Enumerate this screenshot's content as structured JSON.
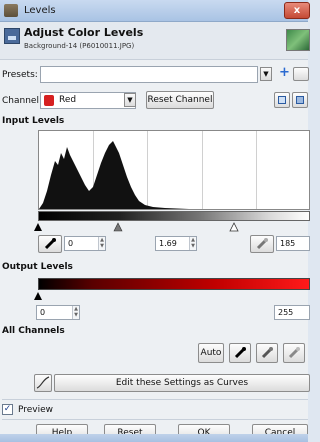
{
  "window": {
    "title": "Levels",
    "close_label": "x"
  },
  "header": {
    "title": "Adjust Color Levels",
    "subtitle": "Background-14 (P6010011.JPG)"
  },
  "presets": {
    "label": "Presets:",
    "value": ""
  },
  "channel": {
    "label": "Channel:",
    "value": "Red",
    "reset_label": "Reset Channel"
  },
  "input_levels": {
    "heading": "Input Levels",
    "low": "0",
    "gamma": "1.69",
    "high": "185"
  },
  "output_levels": {
    "heading": "Output Levels",
    "low": "0",
    "high": "255"
  },
  "all_channels": {
    "heading": "All Channels",
    "auto_label": "Auto"
  },
  "curves_button_label": "Edit these Settings as Curves",
  "preview": {
    "label": "Preview",
    "checked": true
  },
  "footer": {
    "help": "Help",
    "reset": "Reset",
    "ok": "OK",
    "cancel": "Cancel"
  },
  "colors": {
    "channel_accent": "#d62020",
    "output_ramp_end": "#ff1a1a"
  }
}
